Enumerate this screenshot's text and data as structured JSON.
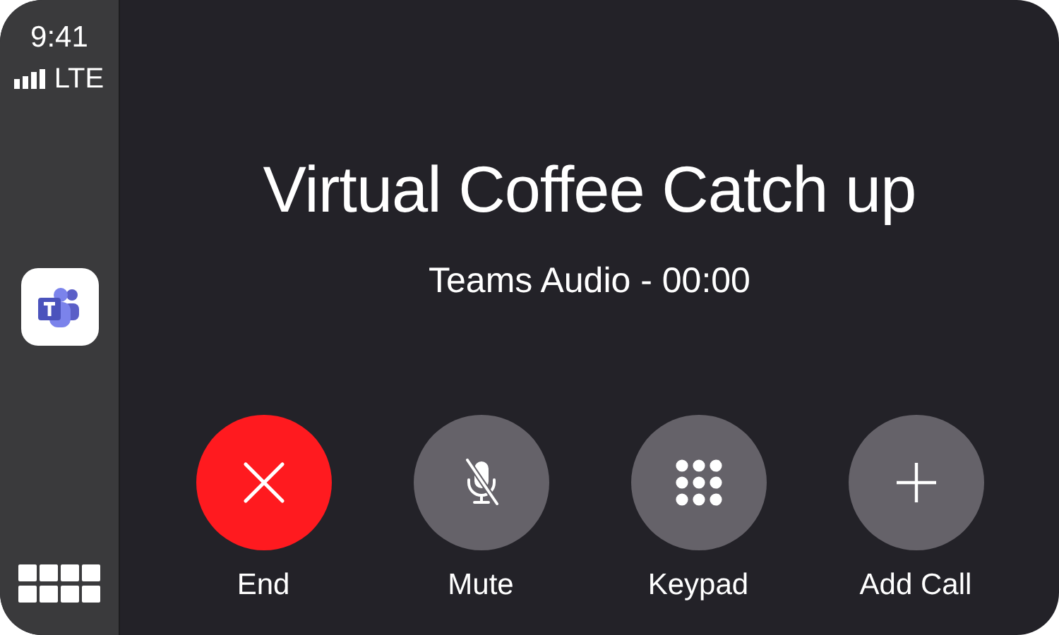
{
  "status": {
    "time": "9:41",
    "network": "LTE"
  },
  "call": {
    "title": "Virtual Coffee Catch up",
    "subtitle": "Teams Audio - 00:00"
  },
  "controls": [
    {
      "kind": "end",
      "label": "End"
    },
    {
      "kind": "mute",
      "label": "Mute"
    },
    {
      "kind": "keypad",
      "label": "Keypad"
    },
    {
      "kind": "add",
      "label": "Add Call"
    }
  ]
}
